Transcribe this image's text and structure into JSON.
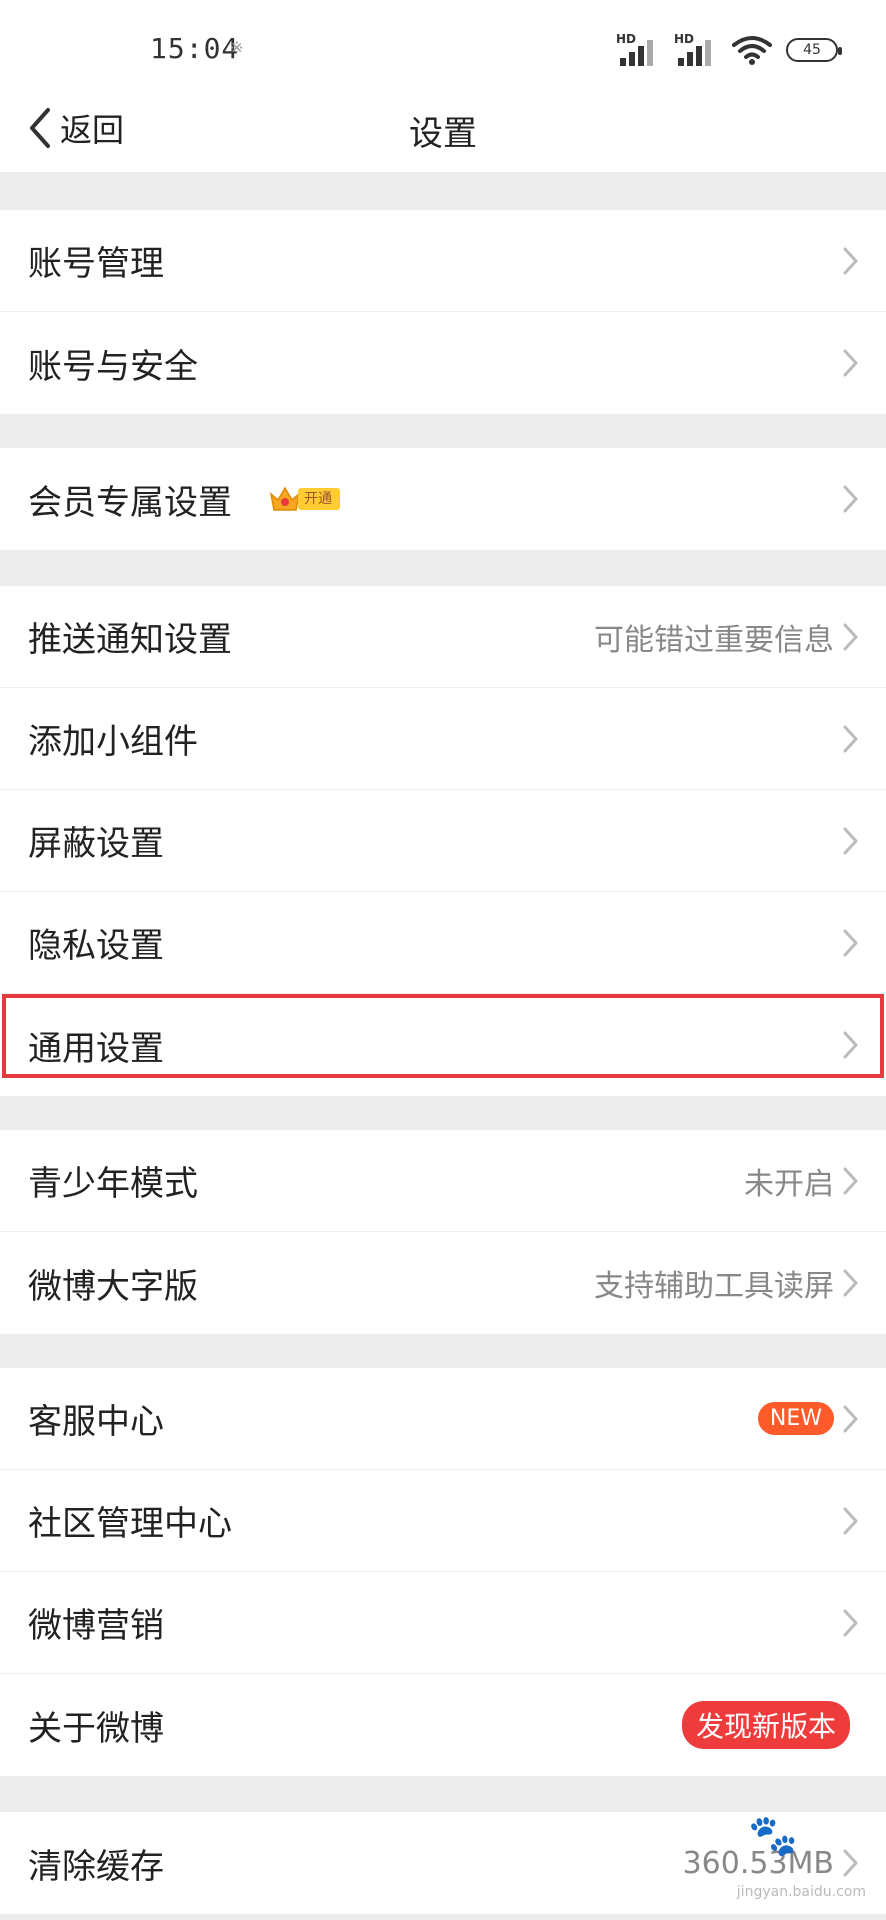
{
  "status_bar": {
    "time": "15:04",
    "time_icon": "※",
    "signal_1": "HD",
    "signal_2": "HD",
    "battery": "45"
  },
  "nav": {
    "back_label": "返回",
    "title": "设置"
  },
  "groups": [
    [
      {
        "label": "账号管理"
      },
      {
        "label": "账号与安全"
      }
    ],
    [
      {
        "label": "会员专属设置",
        "badge": "开通"
      }
    ],
    [
      {
        "label": "推送通知设置",
        "value": "可能错过重要信息"
      },
      {
        "label": "添加小组件"
      },
      {
        "label": "屏蔽设置"
      },
      {
        "label": "隐私设置"
      },
      {
        "label": "通用设置"
      }
    ],
    [
      {
        "label": "青少年模式",
        "value": "未开启"
      },
      {
        "label": "微博大字版",
        "value": "支持辅助工具读屏"
      }
    ],
    [
      {
        "label": "客服中心",
        "badge": "NEW"
      },
      {
        "label": "社区管理中心"
      },
      {
        "label": "微博营销"
      },
      {
        "label": "关于微博",
        "badge": "发现新版本"
      }
    ],
    [
      {
        "label": "清除缓存",
        "value": "360.53MB"
      }
    ]
  ],
  "watermark": "jingyan.baidu.com",
  "colors": {
    "highlight": "#e8393e",
    "new_badge": "#ff5b2a",
    "version_badge": "#ee3b3b"
  }
}
